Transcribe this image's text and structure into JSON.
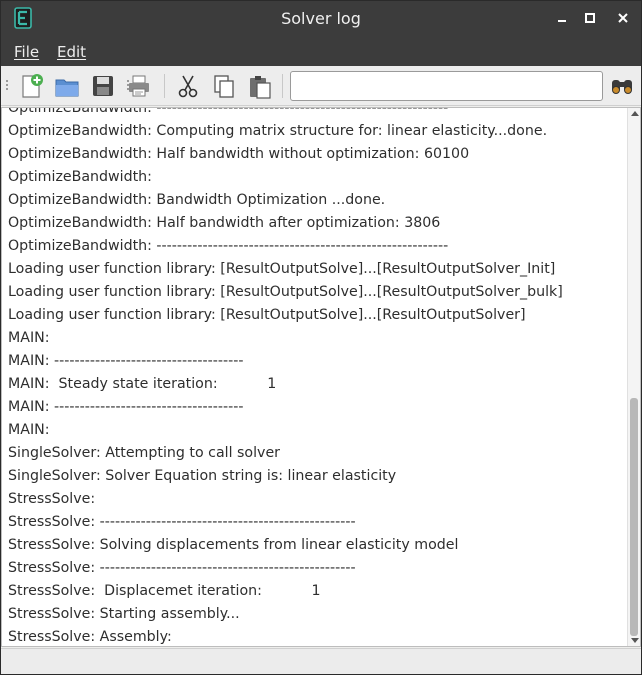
{
  "window": {
    "title": "Solver log"
  },
  "menu": {
    "file": "File",
    "edit": "Edit"
  },
  "toolbar": {
    "buttons": [
      "new-file-icon",
      "open-folder-icon",
      "save-icon",
      "print-icon",
      "cut-icon",
      "copy-icon",
      "paste-icon",
      "find-binoculars-icon"
    ],
    "search_value": ""
  },
  "log": {
    "lines": [
      "OptimizeBandwidth: ---------------------------------------------------------",
      "OptimizeBandwidth: Computing matrix structure for: linear elasticity...done.",
      "OptimizeBandwidth: Half bandwidth without optimization: 60100",
      "OptimizeBandwidth:",
      "OptimizeBandwidth: Bandwidth Optimization ...done.",
      "OptimizeBandwidth: Half bandwidth after optimization: 3806",
      "OptimizeBandwidth: ---------------------------------------------------------",
      "Loading user function library: [ResultOutputSolve]...[ResultOutputSolver_Init]",
      "Loading user function library: [ResultOutputSolve]...[ResultOutputSolver_bulk]",
      "Loading user function library: [ResultOutputSolve]...[ResultOutputSolver]",
      "MAIN:",
      "MAIN: -------------------------------------",
      "MAIN:  Steady state iteration:           1",
      "MAIN: -------------------------------------",
      "MAIN:",
      "SingleSolver: Attempting to call solver",
      "SingleSolver: Solver Equation string is: linear elasticity",
      "StressSolve:",
      "StressSolve: --------------------------------------------------",
      "StressSolve: Solving displacements from linear elasticity model",
      "StressSolve: --------------------------------------------------",
      "StressSolve:  Displacemet iteration:           1",
      "StressSolve: Starting assembly...",
      "StressSolve: Assembly:"
    ]
  },
  "colors": {
    "titlebar": "#3c3c3c",
    "accent": "#3bb8a8"
  }
}
